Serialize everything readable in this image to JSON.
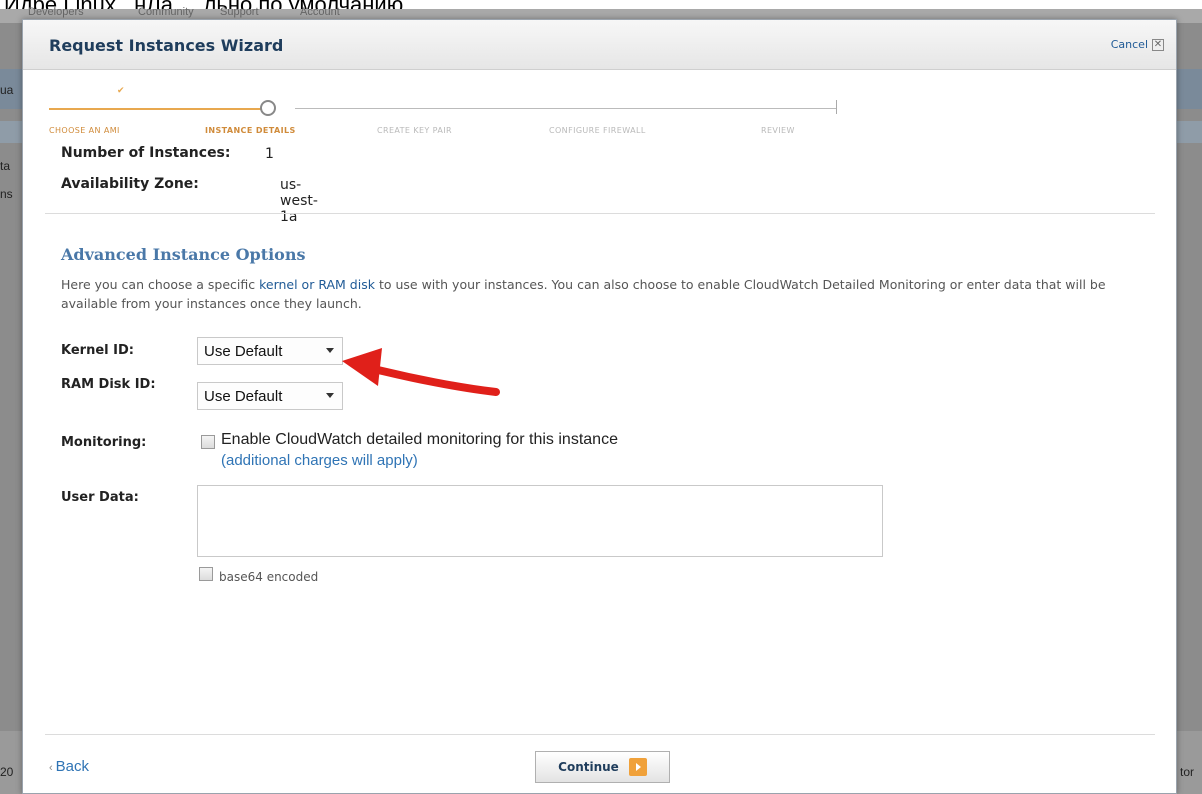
{
  "page_caption": "Идрё Linux ..нЛа ....льно по умолчанию.",
  "background": {
    "nav_items": [
      "Developers",
      "Community",
      "Support",
      "Account"
    ],
    "edge_left": [
      "ua",
      "ta",
      "ns",
      "20"
    ],
    "edge_right": "tor"
  },
  "modal": {
    "title": "Request Instances Wizard",
    "cancel_label": "Cancel",
    "cancel_icon": "close-icon"
  },
  "steps": [
    {
      "label": "CHOOSE AN AMI",
      "state": "done"
    },
    {
      "label": "INSTANCE DETAILS",
      "state": "current"
    },
    {
      "label": "CREATE KEY PAIR",
      "state": "todo"
    },
    {
      "label": "CONFIGURE FIREWALL",
      "state": "todo"
    },
    {
      "label": "REVIEW",
      "state": "todo"
    }
  ],
  "summary": {
    "instances_label": "Number of Instances:",
    "instances_value": "1",
    "zone_label": "Availability Zone:",
    "zone_value": "us-west-1a"
  },
  "advanced": {
    "title": "Advanced Instance Options",
    "desc_prefix": "Here you can choose a specific ",
    "desc_link": "kernel or RAM disk",
    "desc_suffix": " to use with your instances. You can also choose to enable CloudWatch Detailed Monitoring or enter data that will be available from your instances once they launch."
  },
  "form": {
    "kernel_label": "Kernel ID:",
    "kernel_value": "Use Default",
    "ramdisk_label": "RAM Disk ID:",
    "ramdisk_value": "Use Default",
    "monitoring_label": "Monitoring:",
    "monitoring_text": "Enable CloudWatch detailed monitoring for this instance",
    "monitoring_note": "(additional charges will apply)",
    "monitoring_checked": false,
    "userdata_label": "User Data:",
    "userdata_value": "",
    "base64_label": "base64 encoded",
    "base64_checked": false
  },
  "footer": {
    "back_label": "Back",
    "continue_label": "Continue"
  },
  "colors": {
    "accent_orange": "#e8a84f",
    "link_blue": "#2f74b5",
    "title_navy": "#1f3d5c",
    "annotation_red": "#e0201a"
  }
}
